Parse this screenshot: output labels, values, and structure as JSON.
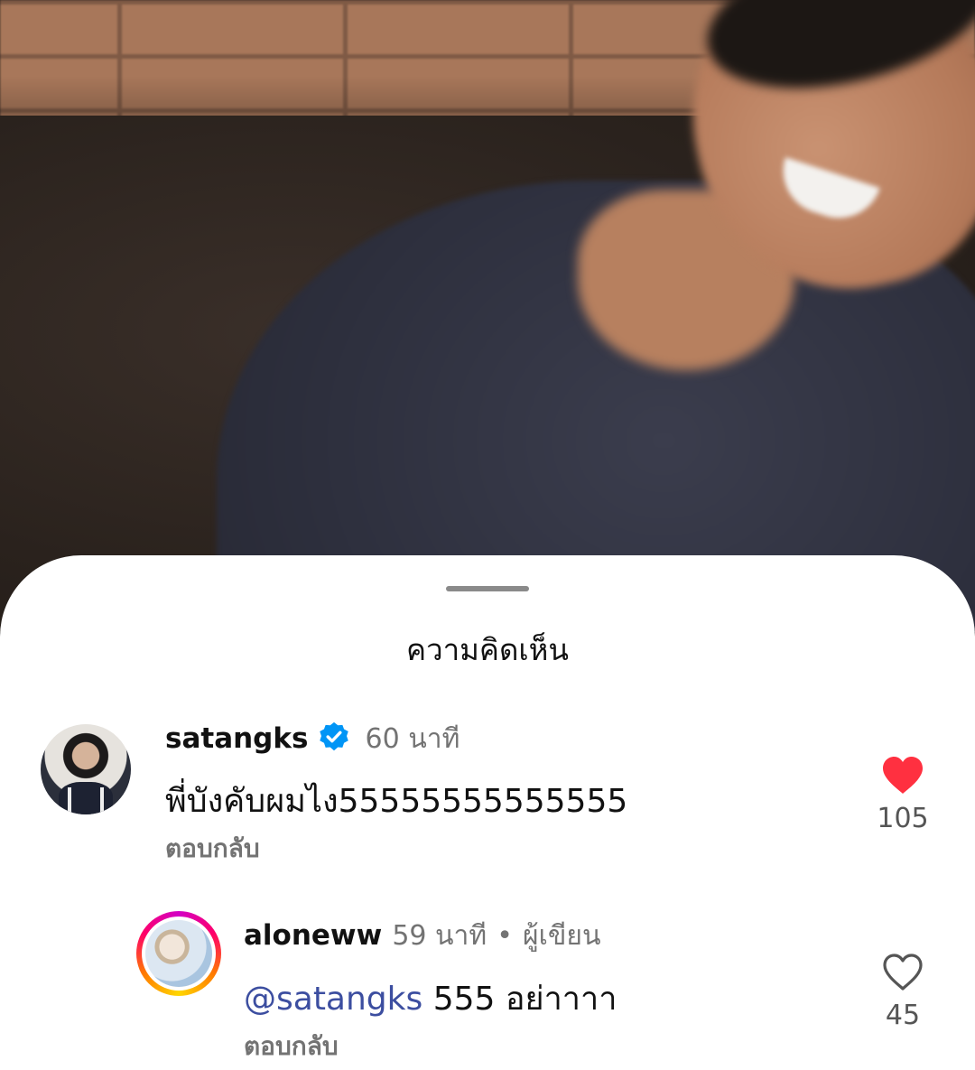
{
  "sheet": {
    "title": "ความคิดเห็น"
  },
  "comments": [
    {
      "username": "satangks",
      "verified": true,
      "time": "60 นาที",
      "text": "พี่บังคับผมไง55555555555555",
      "reply_label": "ตอบกลับ",
      "likes": "105",
      "liked": true,
      "avatar_icon": "avatar-satangks"
    },
    {
      "username": "aloneww",
      "time": "59 นาที",
      "separator": "•",
      "author_badge": "ผู้เขียน",
      "mention": "@satangks",
      "text": " 555 อย่าาาา",
      "reply_label": "ตอบกลับ",
      "likes": "45",
      "liked": false,
      "has_story_ring": true,
      "avatar_icon": "avatar-aloneww"
    }
  ],
  "colors": {
    "like_red": "#ff3040",
    "verified_blue": "#0095f6",
    "mention_blue": "#3c4ea0",
    "muted_gray": "#737373"
  },
  "icons": {
    "heart_filled": "heart-filled-icon",
    "heart_outline": "heart-outline-icon",
    "verified": "verified-badge-icon"
  }
}
